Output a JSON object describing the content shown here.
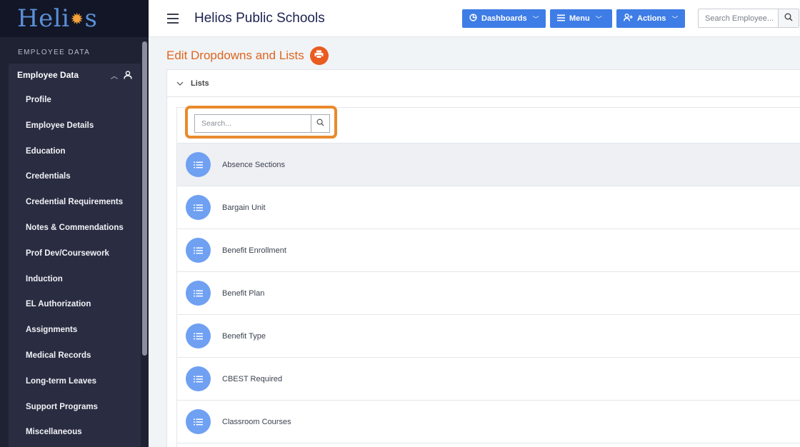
{
  "app": {
    "logo": {
      "text_before": "Heli",
      "text_after": "s"
    },
    "school_name": "Helios Public Schools"
  },
  "header": {
    "buttons": [
      {
        "label": "Dashboards",
        "icon": "pie-chart-icon"
      },
      {
        "label": "Menu",
        "icon": "list-icon"
      },
      {
        "label": "Actions",
        "icon": "user-plus-icon"
      }
    ],
    "search_placeholder": "Search Employee..."
  },
  "sidebar": {
    "section_heading": "EMPLOYEE DATA",
    "group_label": "Employee Data",
    "items": [
      {
        "label": "Profile"
      },
      {
        "label": "Employee Details"
      },
      {
        "label": "Education"
      },
      {
        "label": "Credentials"
      },
      {
        "label": "Credential Requirements"
      },
      {
        "label": "Notes & Commendations"
      },
      {
        "label": "Prof Dev/Coursework"
      },
      {
        "label": "Induction"
      },
      {
        "label": "EL Authorization"
      },
      {
        "label": "Assignments"
      },
      {
        "label": "Medical Records"
      },
      {
        "label": "Long-term Leaves"
      },
      {
        "label": "Support Programs"
      },
      {
        "label": "Miscellaneous"
      }
    ]
  },
  "main": {
    "page_title": "Edit Dropdowns and Lists",
    "lists_header": "Lists",
    "list_search_placeholder": "Search...",
    "list_items": [
      {
        "label": "Absence Sections"
      },
      {
        "label": "Bargain Unit"
      },
      {
        "label": "Benefit Enrollment"
      },
      {
        "label": "Benefit Plan"
      },
      {
        "label": "Benefit Type"
      },
      {
        "label": "CBEST Required"
      },
      {
        "label": "Classroom Courses"
      }
    ]
  },
  "colors": {
    "sidebar_bg": "#1f2233",
    "accent_blue": "#3f7de6",
    "title_orange": "#e0651e",
    "highlight_orange": "#e98a2c",
    "list_icon_blue": "#6fa0f2"
  }
}
